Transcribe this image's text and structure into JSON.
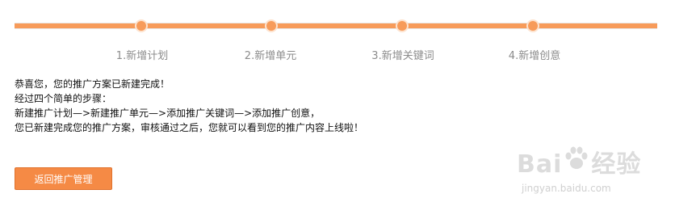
{
  "steps": [
    {
      "label": "1.新增计划"
    },
    {
      "label": "2.新增单元"
    },
    {
      "label": "3.新增关键词"
    },
    {
      "label": "4.新增创意"
    }
  ],
  "message": {
    "line1": "恭喜您，您的推广方案已新建完成！",
    "line2": "经过四个简单的步骤：",
    "line3": "新建推广计划—>新建推广单元—>添加推广关键词—>添加推广创意，",
    "line4": "您已新建完成您的推广方案，审核通过之后，您就可以看到您的推广内容上线啦！"
  },
  "actions": {
    "back_label": "返回推广管理"
  },
  "watermark": {
    "logo_text": "Bai 经验",
    "url": "jingyan.baidu.com"
  },
  "colors": {
    "accent": "#f79b5a",
    "button": "#f58a45",
    "step_text": "#8c8c8c"
  }
}
